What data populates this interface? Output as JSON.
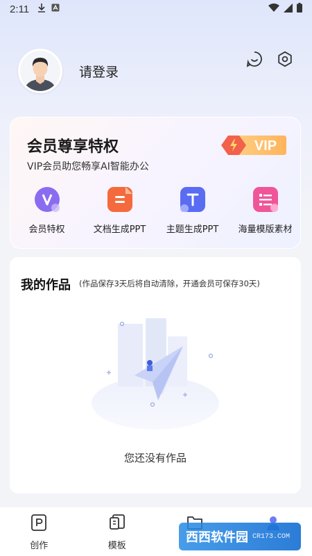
{
  "status_bar": {
    "time": "2:11",
    "icons": [
      "download-icon",
      "a-icon",
      "wifi-icon",
      "signal-icon",
      "battery-icon"
    ]
  },
  "profile": {
    "login_text": "请登录",
    "icons": [
      "smile-icon",
      "settings-icon"
    ]
  },
  "vip_card": {
    "title": "会员尊享特权",
    "subtitle": "VIP会员助您畅享AI智能办公",
    "badge_text": "VIP",
    "items": [
      {
        "label": "会员特权",
        "icon": "vip-v-icon",
        "color": "#8b6cf0"
      },
      {
        "label": "文档生成PPT",
        "icon": "document-icon",
        "color": "#f56a3c"
      },
      {
        "label": "主题生成PPT",
        "icon": "theme-t-icon",
        "color": "#5a6cf2"
      },
      {
        "label": "海量模版素材",
        "icon": "template-list-icon",
        "color": "#f0559a"
      }
    ]
  },
  "works": {
    "title": "我的作品",
    "note": "(作品保存3天后将自动清除，开通会员可保存30天)",
    "empty_text": "您还没有作品"
  },
  "tabbar": {
    "tabs": [
      {
        "label": "创作",
        "icon": "create-p-icon"
      },
      {
        "label": "模板",
        "icon": "template-icon"
      },
      {
        "label": "",
        "icon": "folder-icon"
      },
      {
        "label": "",
        "icon": "user-icon"
      }
    ]
  },
  "watermark": {
    "text": "西西软件园",
    "url": "CR173.COM"
  }
}
